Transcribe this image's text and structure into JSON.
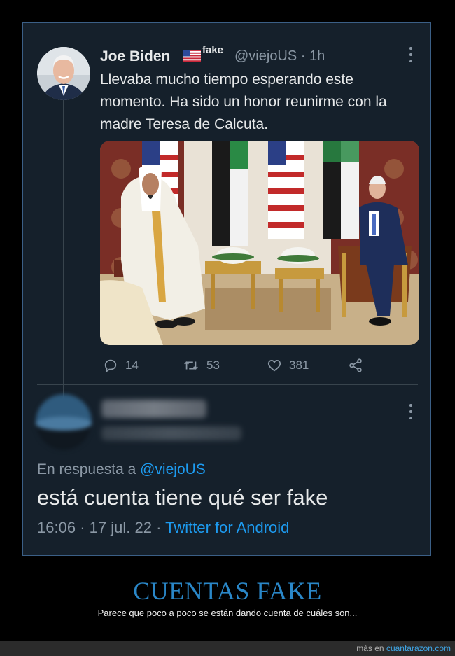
{
  "tweet": {
    "author_name": "Joe Biden",
    "badge": "fake",
    "handle": "@viejoUS",
    "separator": "·",
    "time": "1h",
    "text": "Llevaba mucho tiempo esperando este momento. Ha sido un honor reunirme con la madre Teresa de Calcuta.",
    "actions": {
      "replies": "14",
      "retweets": "53",
      "likes": "381"
    }
  },
  "reply": {
    "in_reply_prefix": "En respuesta a",
    "in_reply_handle": "@viejoUS",
    "text": "está cuenta tiene qué ser fake",
    "time": "16:06",
    "separator1": "·",
    "date": "17 jul. 22",
    "separator2": "·",
    "source": "Twitter for Android"
  },
  "caption": {
    "title": "CUENTAS FAKE",
    "subtitle": "Parece que poco a poco se están dando cuenta de cuáles son..."
  },
  "footer": {
    "prefix": "más en",
    "site": "cuantarazon.com"
  },
  "colors": {
    "background": "#15202b",
    "link": "#1d9bf0",
    "secondary_text": "#8b98a5",
    "caption_title": "#2a87c8"
  },
  "icons": [
    "more-icon",
    "flag-usa-icon",
    "reply-icon",
    "retweet-icon",
    "like-icon",
    "share-icon"
  ]
}
